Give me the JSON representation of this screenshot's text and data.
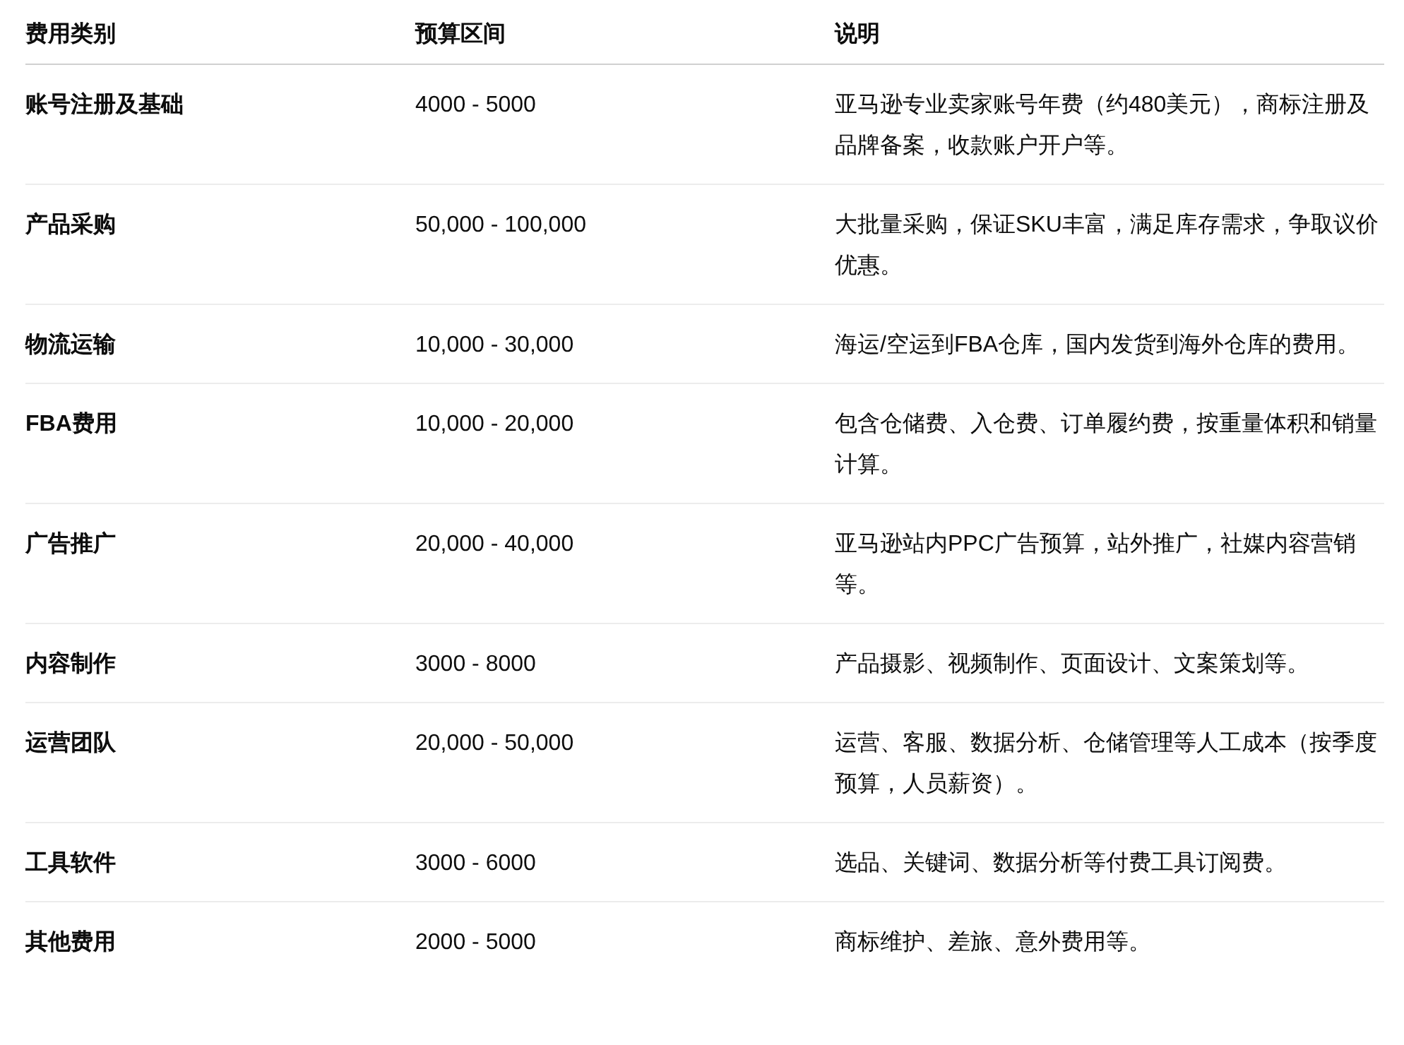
{
  "table": {
    "columns": [
      "费用类别",
      "预算区间",
      "说明"
    ],
    "rows": [
      {
        "category": "账号注册及基础",
        "budget": "4000 - 5000",
        "note": "亚马逊专业卖家账号年费（约480美元），商标注册及品牌备案，收款账户开户等。"
      },
      {
        "category": "产品采购",
        "budget": "50,000 - 100,000",
        "note": "大批量采购，保证SKU丰富，满足库存需求，争取议价优惠。"
      },
      {
        "category": "物流运输",
        "budget": "10,000 - 30,000",
        "note": "海运/空运到FBA仓库，国内发货到海外仓库的费用。"
      },
      {
        "category": "FBA费用",
        "budget": "10,000 - 20,000",
        "note": "包含仓储费、入仓费、订单履约费，按重量体积和销量计算。"
      },
      {
        "category": "广告推广",
        "budget": "20,000 - 40,000",
        "note": "亚马逊站内PPC广告预算，站外推广，社媒内容营销等。"
      },
      {
        "category": "内容制作",
        "budget": "3000 - 8000",
        "note": "产品摄影、视频制作、页面设计、文案策划等。"
      },
      {
        "category": "运营团队",
        "budget": "20,000 - 50,000",
        "note": "运营、客服、数据分析、仓储管理等人工成本（按季度预算，人员薪资）。"
      },
      {
        "category": "工具软件",
        "budget": "3000 - 6000",
        "note": "选品、关键词、数据分析等付费工具订阅费。"
      },
      {
        "category": "其他费用",
        "budget": "2000 - 5000",
        "note": "商标维护、差旅、意外费用等。"
      }
    ]
  }
}
